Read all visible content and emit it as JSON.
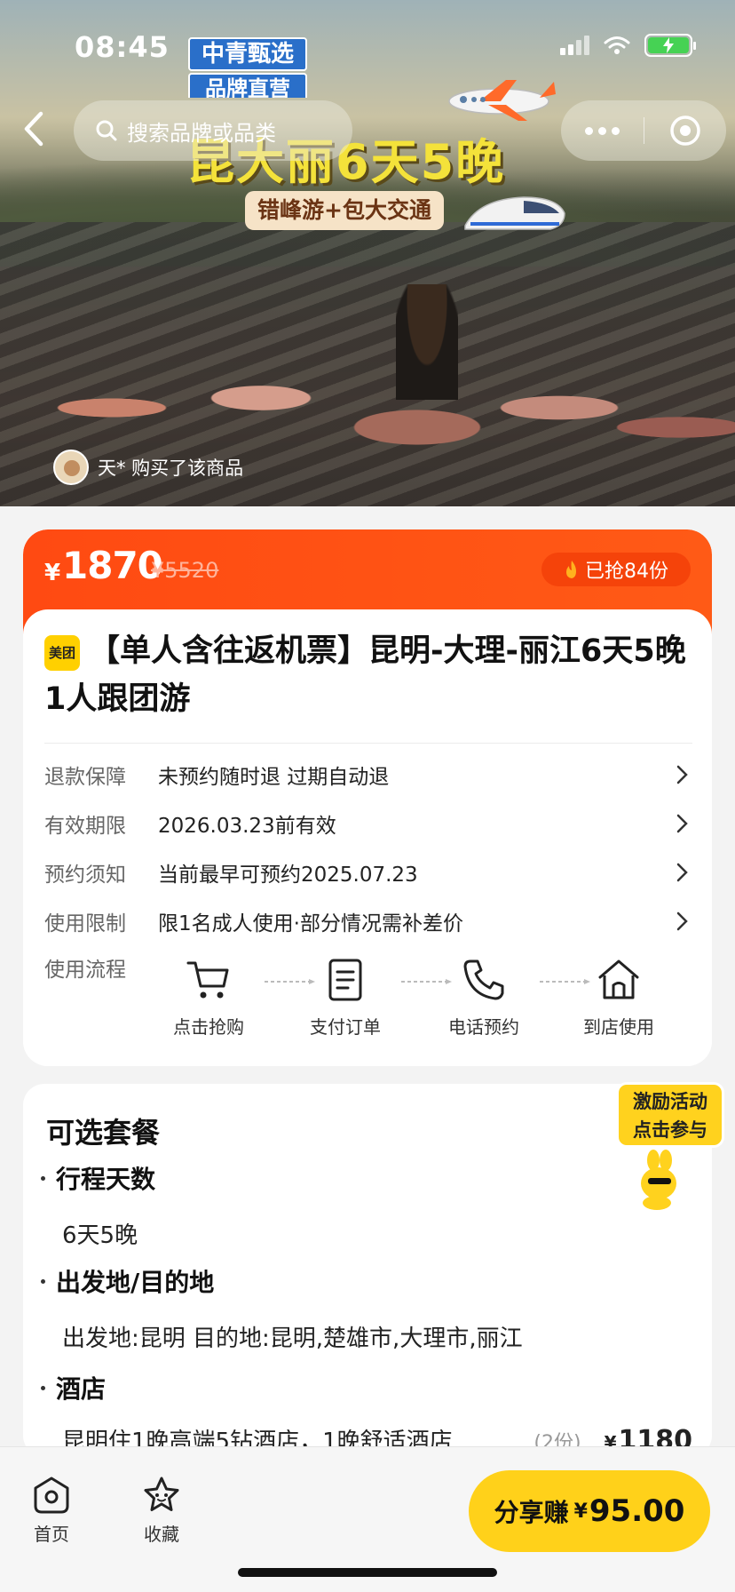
{
  "status_bar": {
    "time": "08:45"
  },
  "hero": {
    "badge_line1": "中青甄选",
    "badge_line2": "品牌直营",
    "title": "昆大丽6天5晚",
    "tag": "错峰游+包大交通",
    "buyer_text": "天* 购买了该商品"
  },
  "search": {
    "placeholder": "搜索品牌或品类"
  },
  "price": {
    "currency": "¥",
    "current": "1870",
    "original": "¥5520",
    "sold": "已抢84份"
  },
  "product": {
    "vendor_logo": "美团",
    "title": "【单人含往返机票】昆明-大理-丽江6天5晚1人跟团游"
  },
  "info_rows": [
    {
      "key": "退款保障",
      "value": "未预约随时退 过期自动退"
    },
    {
      "key": "有效期限",
      "value": "2026.03.23前有效"
    },
    {
      "key": "预约须知",
      "value": "当前最早可预约2025.07.23"
    },
    {
      "key": "使用限制",
      "value": "限1名成人使用·部分情况需补差价"
    }
  ],
  "flow": {
    "label": "使用流程",
    "steps": [
      "点击抢购",
      "支付订单",
      "电话预约",
      "到店使用"
    ]
  },
  "package": {
    "title": "可选套餐",
    "sections": [
      {
        "title": "行程天数",
        "value": "6天5晚"
      },
      {
        "title": "出发地/目的地",
        "value": "出发地:昆明 目的地:昆明,楚雄市,大理市,丽江"
      },
      {
        "title": "酒店"
      }
    ],
    "hotel": {
      "desc": "昆明住1晚高端5钻酒店，1晚舒适酒店",
      "qty": "(2份)",
      "price": "1180"
    }
  },
  "promo": {
    "line1": "激励活动",
    "line2": "点击参与"
  },
  "bottom": {
    "home_label": "首页",
    "fav_label": "收藏",
    "share_label": "分享赚",
    "share_currency": "¥",
    "share_amount": "95.00"
  },
  "colors": {
    "price_bar": "#ff4a12",
    "share_button": "#ffd11a",
    "vendor_logo": "#ffd000"
  }
}
